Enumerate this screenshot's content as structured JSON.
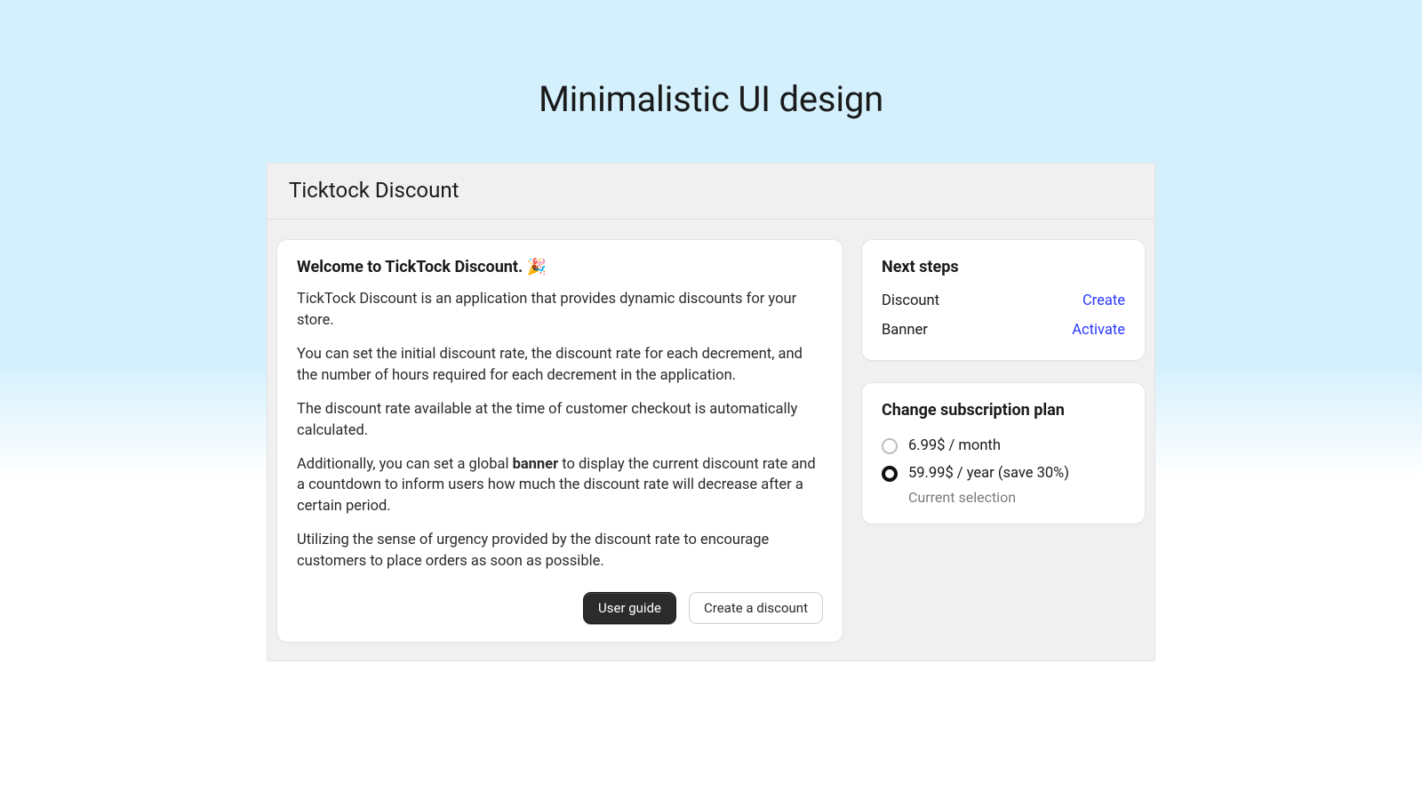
{
  "page": {
    "heading": "Minimalistic UI design"
  },
  "panel": {
    "title": "Ticktock Discount"
  },
  "welcome": {
    "title_prefix": "Welcome to TickTock Discount.",
    "title_emoji": "🎉",
    "p1": "TickTock Discount is an application that provides dynamic discounts for your store.",
    "p2": "You can set the initial discount rate, the discount rate for each decrement, and the number of hours required for each decrement in the application.",
    "p3": "The discount rate available at the time of customer checkout is automatically calculated.",
    "p4_before": "Additionally, you can set a global ",
    "p4_bold": "banner",
    "p4_after": " to display the current discount rate and a countdown to inform users how much the discount rate will decrease after a certain period.",
    "p5": "Utilizing the sense of urgency provided by the discount rate to encourage customers to place orders as soon as possible.",
    "actions": {
      "user_guide": "User guide",
      "create_discount": "Create a discount"
    }
  },
  "next_steps": {
    "title": "Next steps",
    "items": [
      {
        "label": "Discount",
        "action": "Create"
      },
      {
        "label": "Banner",
        "action": "Activate"
      }
    ]
  },
  "subscription": {
    "title": "Change subscription plan",
    "options": [
      {
        "label": "6.99$ / month",
        "selected": false
      },
      {
        "label": "59.99$ / year (save 30%)",
        "selected": true
      }
    ],
    "current_hint": "Current selection"
  }
}
